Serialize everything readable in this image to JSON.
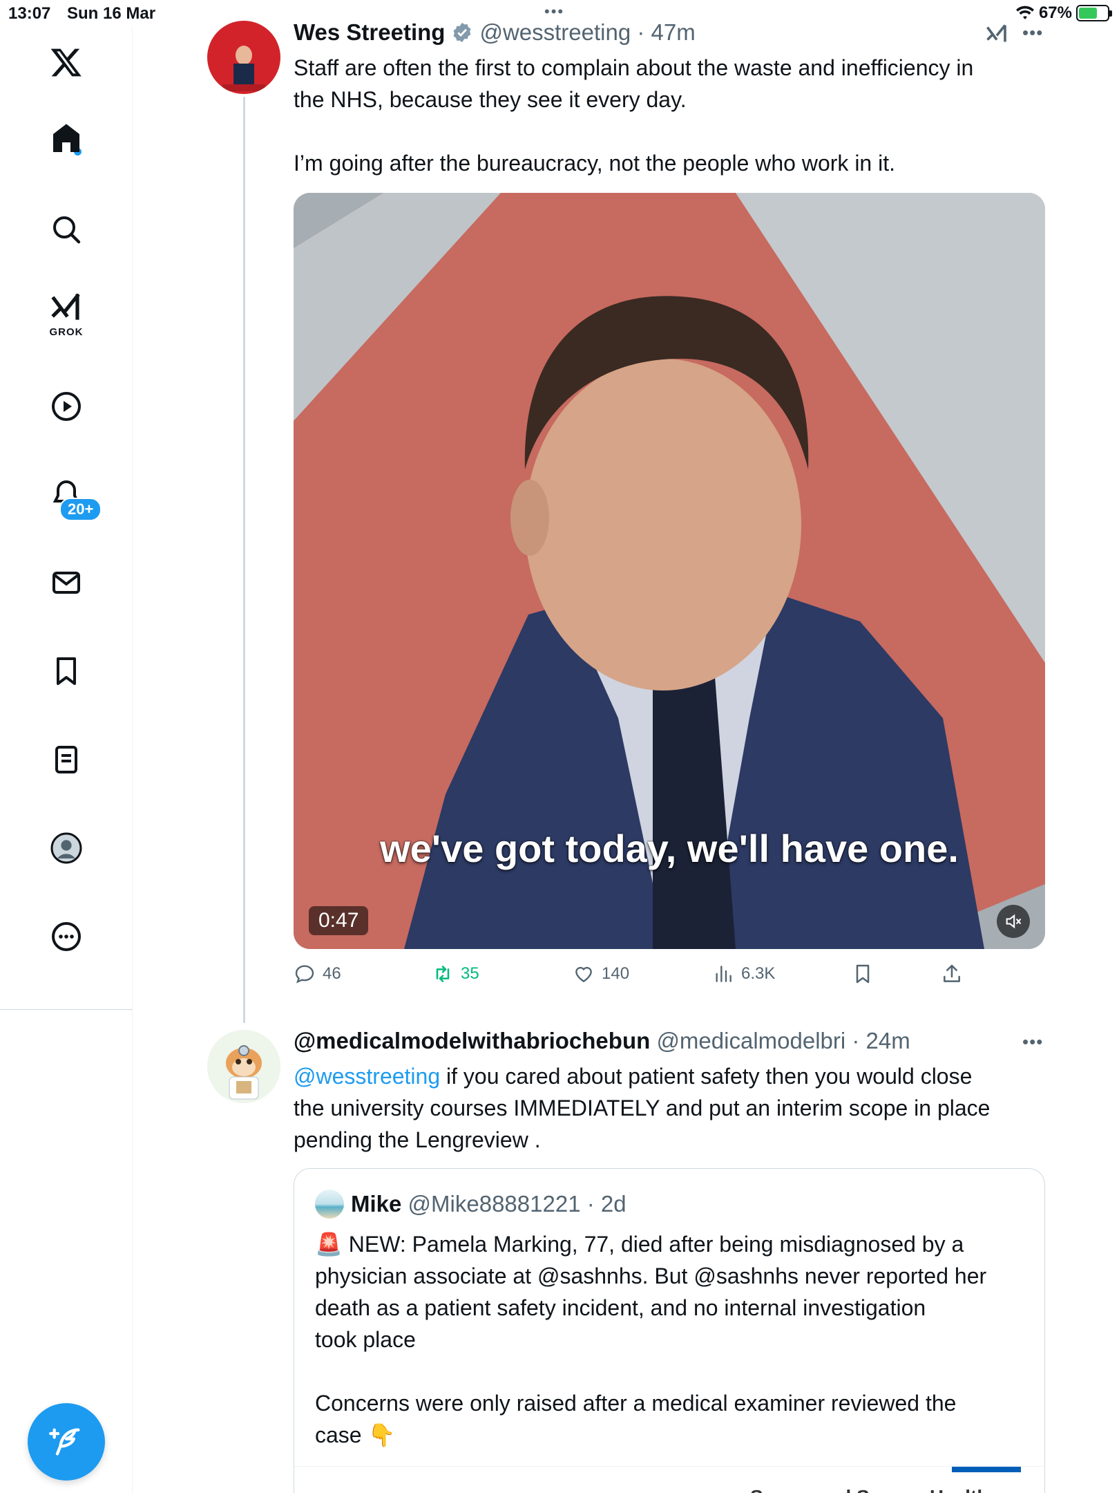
{
  "status_bar": {
    "time": "13:07",
    "date": "Sun 16 Mar",
    "battery": "67%"
  },
  "sidebar": {
    "items": [
      {
        "name": "x-logo"
      },
      {
        "name": "home"
      },
      {
        "name": "search"
      },
      {
        "name": "grok",
        "label": "GROK"
      },
      {
        "name": "video"
      },
      {
        "name": "notifications",
        "badge": "20+"
      },
      {
        "name": "messages"
      },
      {
        "name": "bookmarks"
      },
      {
        "name": "lists"
      },
      {
        "name": "profile"
      },
      {
        "name": "more"
      }
    ]
  },
  "tweet1": {
    "name": "Wes Streeting",
    "handle": "@wesstreeting",
    "time": "47m",
    "text_line1": "Staff are often the first to complain about the waste and inefficiency in",
    "text_line2": "the NHS, because they see it every day.",
    "text_line3": "I’m going after the bureaucracy, not the people who work in it.",
    "video": {
      "caption": "we've got today, we'll have one.",
      "duration": "0:47"
    },
    "stats": {
      "replies": "46",
      "retweets": "35",
      "likes": "140",
      "views": "6.3K"
    }
  },
  "tweet2": {
    "name": "@medicalmodelwithabriochebun",
    "handle": "@medicalmodelbri",
    "time": "24m",
    "mention": "@wesstreeting",
    "text_line1": " if you cared about patient safety then you would close",
    "text_line2": "the university courses IMMEDIATELY and put an interim scope in place",
    "text_line3": "pending the Lengreview .",
    "quote": {
      "name": "Mike",
      "handle": "@Mike88881221",
      "time": "2d",
      "emoji1": "🚨",
      "line1": " NEW: Pamela Marking, 77, died after being misdiagnosed by a",
      "line2": "physician associate at @sashnhs. But @sashnhs never reported her",
      "line3": "death as a patient safety incident, and no internal investigation",
      "line4": "took place",
      "line5": "Concerns were only raised after a medical examiner reviewed the",
      "line6": "case ",
      "emoji2": "👇",
      "image_text": "Surrey and Sussex Healthcare"
    }
  },
  "colors": {
    "accent": "#1d9bf0",
    "retweet": "#00ba7c",
    "muted": "#536471"
  }
}
